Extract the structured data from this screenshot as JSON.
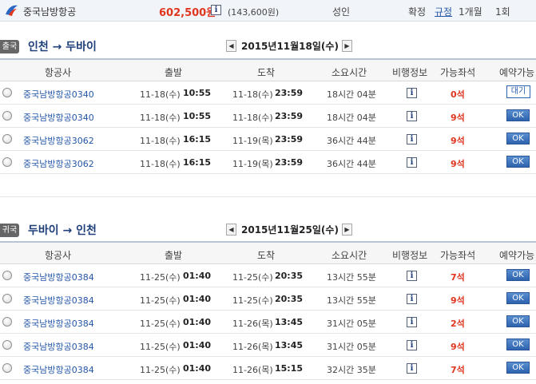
{
  "summary": {
    "airline": "중국남방항공",
    "price": "602,500원",
    "price_sub": "(143,600원)",
    "passenger": "성인",
    "confirm": "확정",
    "rule_link": "규정",
    "validity": "1개월",
    "count": "1회"
  },
  "icons": {
    "info": "i",
    "prev": "◀",
    "next": "▶"
  },
  "columns": {
    "airline": "항공사",
    "depart": "출발",
    "arrive": "도착",
    "duration": "소요시간",
    "flight_info": "비행정보",
    "seats": "가능좌석",
    "reserve_out": "예약가능",
    "reserve_in": "예약가능"
  },
  "outbound": {
    "badge": "출국",
    "route": "인천 → 두바이",
    "date": "2015년11월18일(수)",
    "rows": [
      {
        "airline": "중국남방항공0340",
        "dep_day": "11-18(수)",
        "dep_time": "10:55",
        "arr_day": "11-18(수)",
        "arr_time": "23:59",
        "duration": "18시간 04분",
        "seats": "0석",
        "action": "대기"
      },
      {
        "airline": "중국남방항공0340",
        "dep_day": "11-18(수)",
        "dep_time": "10:55",
        "arr_day": "11-18(수)",
        "arr_time": "23:59",
        "duration": "18시간 04분",
        "seats": "9석",
        "action": "OK"
      },
      {
        "airline": "중국남방항공3062",
        "dep_day": "11-18(수)",
        "dep_time": "16:15",
        "arr_day": "11-19(목)",
        "arr_time": "23:59",
        "duration": "36시간 44분",
        "seats": "9석",
        "action": "OK"
      },
      {
        "airline": "중국남방항공3062",
        "dep_day": "11-18(수)",
        "dep_time": "16:15",
        "arr_day": "11-19(목)",
        "arr_time": "23:59",
        "duration": "36시간 44분",
        "seats": "9석",
        "action": "OK"
      }
    ]
  },
  "inbound": {
    "badge": "귀국",
    "route": "두바이 → 인천",
    "date": "2015년11월25일(수)",
    "rows": [
      {
        "airline": "중국남방항공0384",
        "dep_day": "11-25(수)",
        "dep_time": "01:40",
        "arr_day": "11-25(수)",
        "arr_time": "20:35",
        "duration": "13시간 55분",
        "seats": "7석",
        "action": "OK"
      },
      {
        "airline": "중국남방항공0384",
        "dep_day": "11-25(수)",
        "dep_time": "01:40",
        "arr_day": "11-25(수)",
        "arr_time": "20:35",
        "duration": "13시간 55분",
        "seats": "9석",
        "action": "OK"
      },
      {
        "airline": "중국남방항공0384",
        "dep_day": "11-25(수)",
        "dep_time": "01:40",
        "arr_day": "11-26(목)",
        "arr_time": "13:45",
        "duration": "31시간 05분",
        "seats": "2석",
        "action": "OK"
      },
      {
        "airline": "중국남방항공0384",
        "dep_day": "11-25(수)",
        "dep_time": "01:40",
        "arr_day": "11-26(목)",
        "arr_time": "13:45",
        "duration": "31시간 05분",
        "seats": "9석",
        "action": "OK"
      },
      {
        "airline": "중국남방항공0384",
        "dep_day": "11-25(수)",
        "dep_time": "01:40",
        "arr_day": "11-26(목)",
        "arr_time": "15:15",
        "duration": "32시간 35분",
        "seats": "7석",
        "action": "OK"
      }
    ]
  },
  "colors": {
    "price": "#e0351f",
    "link": "#2456a8",
    "route": "#1e3f7a",
    "ok_button": "#2d62ae"
  }
}
